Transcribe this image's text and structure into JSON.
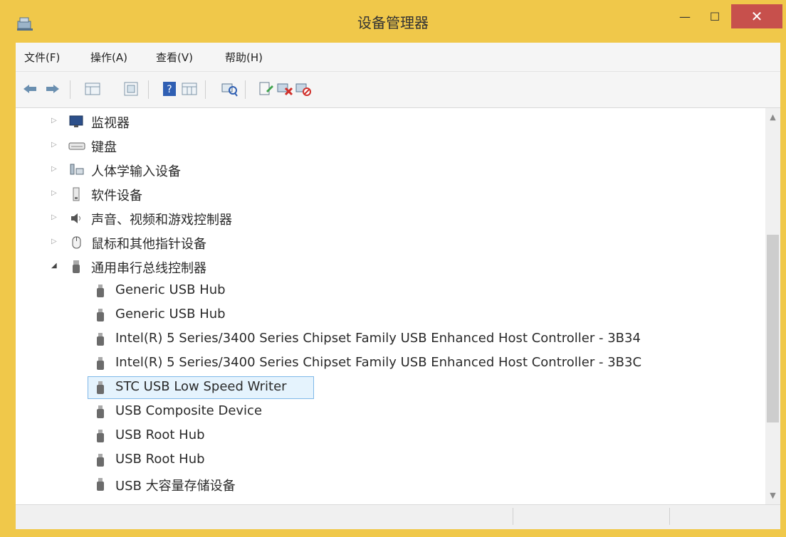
{
  "window": {
    "title": "设备管理器",
    "controls": {
      "minimize": "—",
      "maximize": "☐",
      "close": "✕"
    },
    "colors": {
      "frame": "#f0c84a",
      "close": "#c7504c",
      "selection_bg": "#e5f3fd",
      "selection_border": "#7fb8e8"
    }
  },
  "menu": [
    {
      "label": "文件(F)"
    },
    {
      "label": "操作(A)"
    },
    {
      "label": "查看(V)"
    },
    {
      "label": "帮助(H)"
    }
  ],
  "toolbar": {
    "buttons": [
      "back-arrow-icon",
      "forward-arrow-icon",
      "properties-grid-icon",
      "device-list-icon",
      "help-icon",
      "view-grid-icon",
      "scan-hardware-icon",
      "update-driver-icon",
      "uninstall-device-icon",
      "disable-device-icon"
    ]
  },
  "tree": {
    "categories": [
      {
        "label": "监视器",
        "expanded": false,
        "icon": "monitor-icon"
      },
      {
        "label": "键盘",
        "expanded": false,
        "icon": "keyboard-icon"
      },
      {
        "label": "人体学输入设备",
        "expanded": false,
        "icon": "hid-icon"
      },
      {
        "label": "软件设备",
        "expanded": false,
        "icon": "software-device-icon"
      },
      {
        "label": "声音、视频和游戏控制器",
        "expanded": false,
        "icon": "speaker-icon"
      },
      {
        "label": "鼠标和其他指针设备",
        "expanded": false,
        "icon": "mouse-icon"
      },
      {
        "label": "通用串行总线控制器",
        "expanded": true,
        "icon": "usb-icon"
      }
    ],
    "usb_children": [
      {
        "label": "Generic USB Hub",
        "selected": false
      },
      {
        "label": "Generic USB Hub",
        "selected": false
      },
      {
        "label": "Intel(R) 5 Series/3400 Series Chipset Family USB Enhanced Host Controller - 3B34",
        "selected": false
      },
      {
        "label": "Intel(R) 5 Series/3400 Series Chipset Family USB Enhanced Host Controller - 3B3C",
        "selected": false
      },
      {
        "label": "STC USB Low Speed Writer",
        "selected": true
      },
      {
        "label": "USB Composite Device",
        "selected": false
      },
      {
        "label": "USB Root Hub",
        "selected": false
      },
      {
        "label": "USB Root Hub",
        "selected": false
      },
      {
        "label": "USB 大容量存储设备",
        "selected": false
      }
    ]
  }
}
